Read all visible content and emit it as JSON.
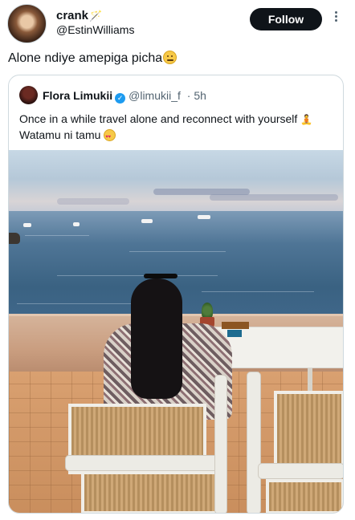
{
  "author": {
    "display_name": "crank",
    "name_emoji": "🪄",
    "handle": "@EstinWilliams",
    "avatar_icon": "user-avatar"
  },
  "follow_button": {
    "label": "Follow"
  },
  "tweet": {
    "text": "Alone ndiye amepiga picha",
    "emoji": "face-with-rolling-eyes-emoji"
  },
  "quoted_tweet": {
    "display_name": "Flora Limukii",
    "verified_icon": "verified-badge-icon",
    "handle": "@limukii_f",
    "time": "· 5h",
    "line1": "Once in a while travel alone and reconnect with yourself",
    "line1_emoji": "🧘",
    "line2": "Watamu ni tamu",
    "line2_emoji": "smiling-face-with-heart-eyes-emoji",
    "photo_description_icon": "photo-woman-sitting-by-sea"
  },
  "colors": {
    "accent": "#1d9bf0",
    "follow_bg": "#0f1419",
    "text": "#0f1419",
    "muted": "#536471"
  }
}
